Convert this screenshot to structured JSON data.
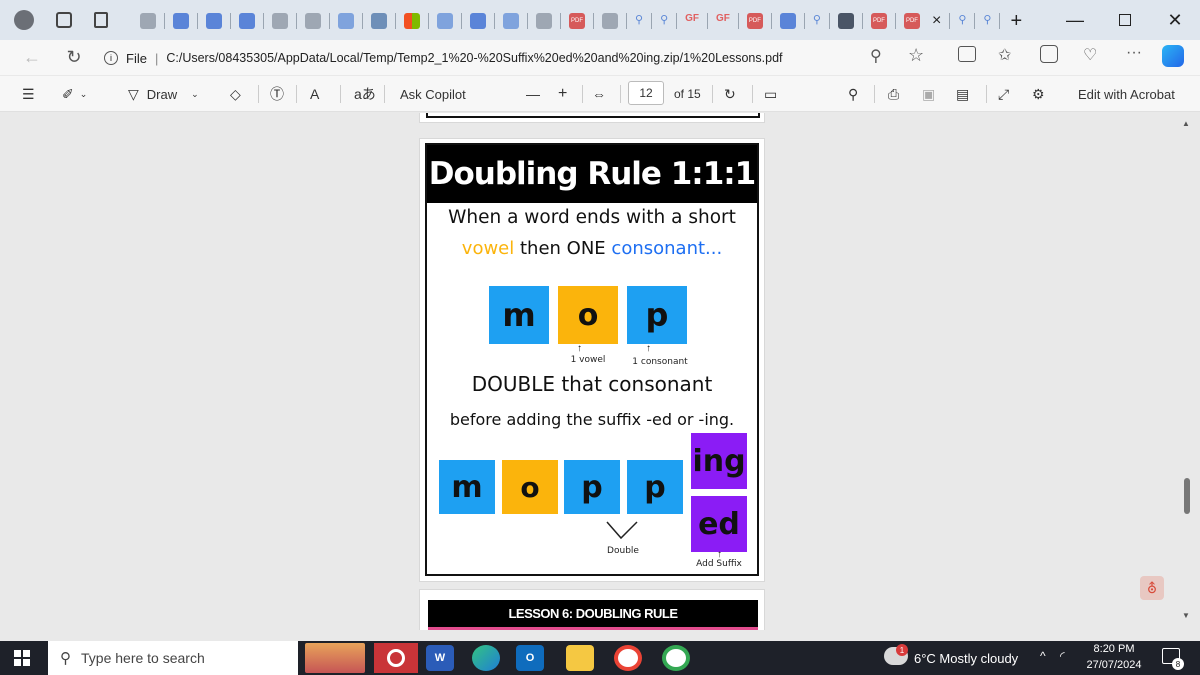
{
  "tabbar": {
    "gf_label_1": "GF",
    "gf_label_2": "GF",
    "pdf_badge_1": "PDF",
    "pdf_badge_2": "PDF",
    "pdf_badge_3": "PDF",
    "pdf_badge_4": "PDF",
    "pdf_badge_5": "PDF",
    "close_tab": "×",
    "new_tab": "+"
  },
  "address": {
    "file_label": "File",
    "url": "C:/Users/08435305/AppData/Local/Temp/Temp2_1%20-%20Suffix%20ed%20and%20ing.zip/1%20Lessons.pdf"
  },
  "pdf_toolbar": {
    "draw_label": "Draw",
    "ask_copilot": "Ask Copilot",
    "page_number": "12",
    "page_total": "of 15",
    "edit_acrobat": "Edit with Acrobat"
  },
  "slide": {
    "title": "Doubling Rule 1:1:1",
    "line1": "When a word ends with a short",
    "line2_vowel": "vowel",
    "line2_then": "then ONE",
    "line2_consonant": "consonant...",
    "tiles_top": [
      "m",
      "o",
      "p"
    ],
    "label_vowel": "1 vowel",
    "label_consonant": "1 consonant",
    "double_line": "DOUBLE that consonant",
    "suffix_line": "before adding the suffix -ed or -ing.",
    "tiles_bottom": [
      "m",
      "o",
      "p",
      "p"
    ],
    "suffix_ing": "ing",
    "suffix_ed": "ed",
    "label_double": "Double",
    "label_add_suffix": "Add Suffix",
    "next_page_title": "LESSON 6: DOUBLING RULE"
  },
  "taskbar": {
    "search_placeholder": "Type here to search",
    "weather": "6°C  Mostly cloudy",
    "time": "8:20 PM",
    "date": "27/07/2024",
    "notifications": "8",
    "weather_badge": "1"
  },
  "colors": {
    "vowel_orange": "#fbb40c",
    "consonant_blue": "#1ea0f2",
    "suffix_purple": "#8b1cf5"
  }
}
